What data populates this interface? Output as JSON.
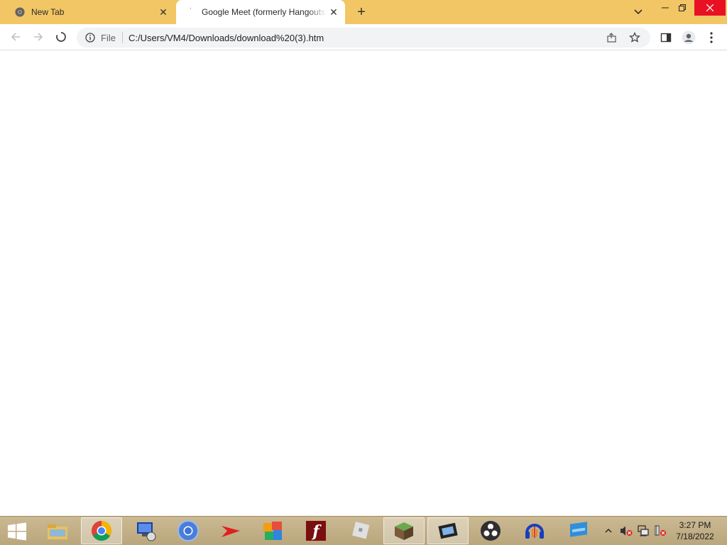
{
  "browser": {
    "tabs": [
      {
        "title": "New Tab",
        "active": false,
        "favicon": "chrome-icon"
      },
      {
        "title": "Google Meet (formerly Hangouts",
        "active": true,
        "favicon": "loading-icon"
      }
    ],
    "new_tab_glyph": "+",
    "close_glyph": "✕"
  },
  "toolbar": {
    "scheme_label": "File",
    "url": "C:/Users/VM4/Downloads/download%20(3).htm"
  },
  "taskbar": {
    "apps": [
      "file-explorer-icon",
      "chrome-icon",
      "remote-desktop-icon",
      "chromium-icon",
      "arrow-app-icon",
      "colorful-blocks-icon",
      "flash-player-icon",
      "roblox-icon",
      "minecraft-icon",
      "video-editor-icon",
      "obs-icon",
      "audacity-icon",
      "blue-app-icon"
    ],
    "time": "3:27 PM",
    "date": "7/18/2022"
  },
  "colors": {
    "tabstrip": "#f2c664",
    "omnibox": "#f1f3f4",
    "taskbar": "#c4b185"
  }
}
